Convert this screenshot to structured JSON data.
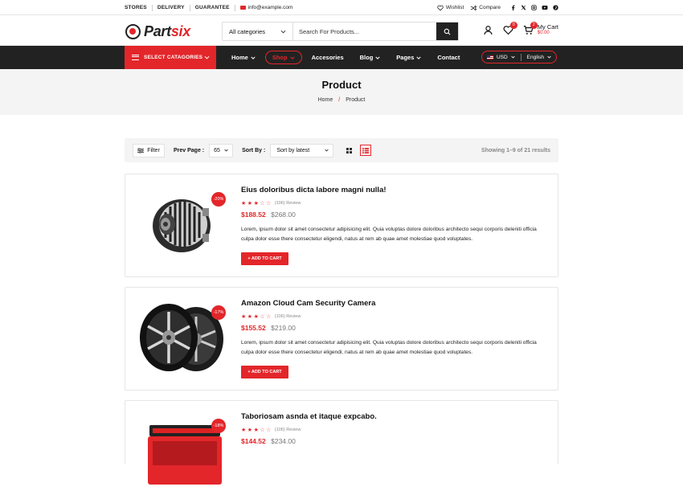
{
  "topbar": {
    "links": [
      "STORES",
      "DELIVERY",
      "GUARANTEE"
    ],
    "email": "info@example.com",
    "wishlist": "Wishlist",
    "compare": "Compare",
    "social": [
      "facebook-icon",
      "twitter-icon",
      "instagram-icon",
      "youtube-icon",
      "pinterest-icon"
    ]
  },
  "header": {
    "logo_part1": "Part",
    "logo_part2": "six",
    "category_select": "All categories",
    "search_placeholder": "Search For Products...",
    "wishlist_count": "0",
    "cart_count": "2",
    "cart_label": "My Cart",
    "cart_total": "$0.00"
  },
  "nav": {
    "categories_button": "SELECT CATAGORIES",
    "items": [
      {
        "label": "Home",
        "dropdown": true
      },
      {
        "label": "Shop",
        "dropdown": true,
        "active": true
      },
      {
        "label": "Accesories",
        "dropdown": false
      },
      {
        "label": "Blog",
        "dropdown": true
      },
      {
        "label": "Pages",
        "dropdown": true
      },
      {
        "label": "Contact",
        "dropdown": false
      }
    ],
    "currency": "USD",
    "language": "English"
  },
  "banner": {
    "title": "Product",
    "breadcrumb": [
      "Home",
      "Product"
    ]
  },
  "toolbar": {
    "filter_label": "Filter",
    "per_page_label": "Prev Page :",
    "per_page_value": "65",
    "sort_label": "Sort By :",
    "sort_value": "Sort by latest",
    "active_view": "list",
    "showing": "Showing 1–9 of 21 results"
  },
  "products": [
    {
      "title": "Eius doloribus dicta labore magni nulla!",
      "discount": "-20%",
      "rating": 3,
      "reviews": "(106) Review",
      "price": "$188.52",
      "old_price": "$268.00",
      "description": "Lorem, ipsum dolor sit amet consectetur adipisicing elit. Quia voluptas dolore doloribus architecto sequi corporis deleniti officia culpa dolor esse there consectetur eligendi, natus at rem ab quae amet molestiae quod voluptates.",
      "button": "+ ADD TO CART",
      "image": "alternator"
    },
    {
      "title": "Amazon Cloud Cam Security Camera",
      "discount": "-17%",
      "rating": 3,
      "reviews": "(106) Review",
      "price": "$155.52",
      "old_price": "$219.00",
      "description": "Lorem, ipsum dolor sit amet consectetur adipisicing elit. Quia voluptas dolore doloribus architecto sequi corporis deleniti officia culpa dolor esse there consectetur eligendi, natus at rem ab quae amet molestiae quod voluptates.",
      "button": "+ ADD TO CART",
      "image": "wheels"
    },
    {
      "title": "Taboriosam asnda et itaque expcabo.",
      "discount": "-18%",
      "rating": 3,
      "reviews": "(106) Review",
      "price": "$144.52",
      "old_price": "$234.00",
      "image": "battery"
    }
  ]
}
